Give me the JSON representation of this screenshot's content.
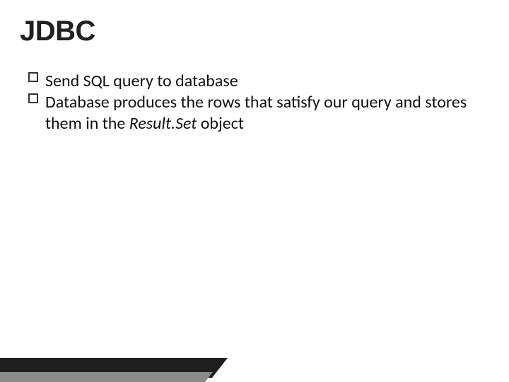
{
  "title": "JDBC",
  "bullets": [
    {
      "text": "Send SQL query to database"
    },
    {
      "prefix": "Database produces the rows that satisfy our query and stores them in the ",
      "emphasis": "Result.Set",
      "suffix": " object"
    }
  ]
}
